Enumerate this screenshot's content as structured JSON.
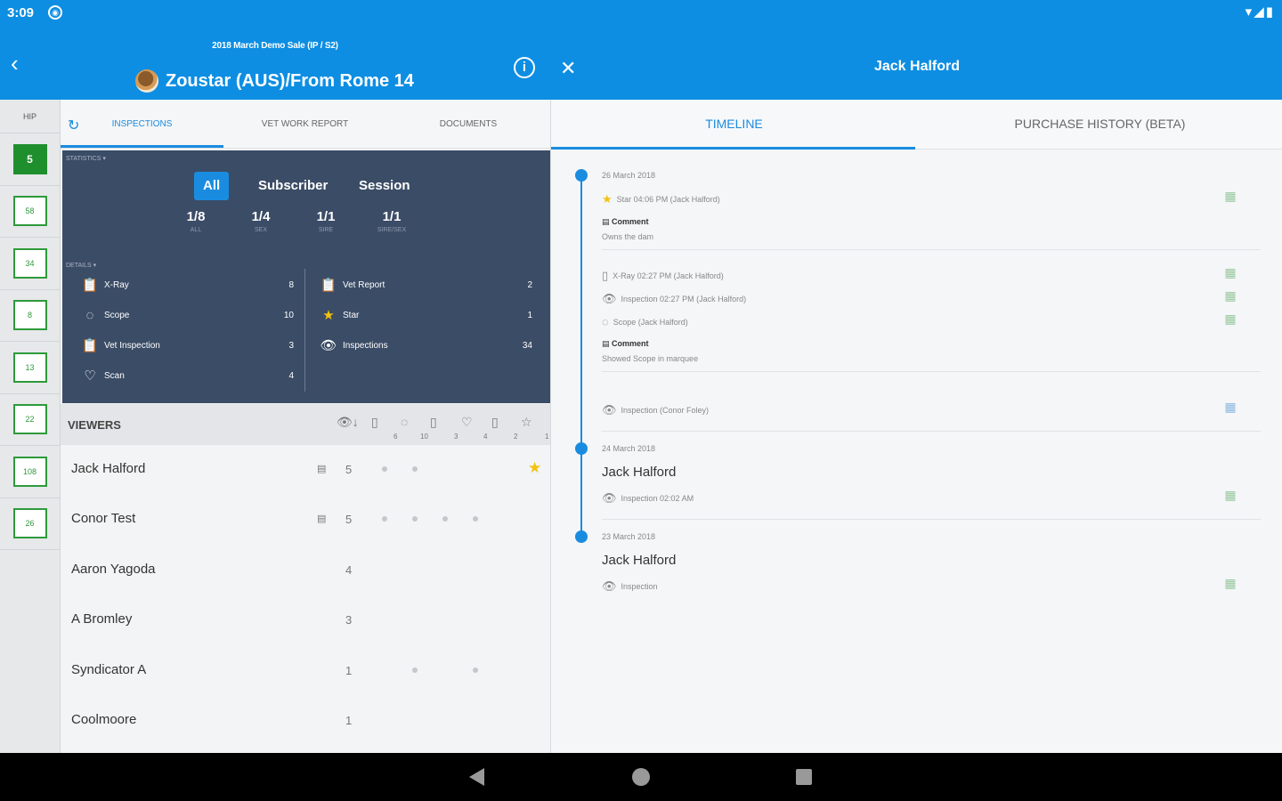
{
  "status": {
    "time": "3:09",
    "notification_icon": "notification-circle-icon",
    "system_icons": "▾◢▮"
  },
  "header": {
    "sale_title": "2018 March Demo Sale (IP / S2)",
    "horse_name": "Zoustar (AUS)/From Rome 14",
    "person_name": "Jack Halford",
    "back_glyph": "‹",
    "info_glyph": "i",
    "close_glyph": "✕"
  },
  "hip_list": {
    "label": "HIP",
    "items": [
      "5",
      "58",
      "34",
      "8",
      "13",
      "22",
      "108",
      "26"
    ]
  },
  "left_tabs": {
    "refresh_glyph": "↻",
    "items": [
      "INSPECTIONS",
      "VET WORK REPORT",
      "DOCUMENTS"
    ]
  },
  "statistics": {
    "label": "STATISTICS ▾",
    "segments": [
      "All",
      "Subscriber",
      "Session"
    ],
    "fractions": [
      {
        "value": "1/8",
        "caption": "ALL"
      },
      {
        "value": "1/4",
        "caption": "SEX"
      },
      {
        "value": "1/1",
        "caption": "SIRE"
      },
      {
        "value": "1/1",
        "caption": "SIRE/SEX"
      }
    ]
  },
  "details": {
    "label": "DETAILS ▾",
    "left": [
      {
        "icon": "clipboard-icon",
        "glyph": "📋",
        "label": "X-Ray",
        "count": "8"
      },
      {
        "icon": "scope-icon",
        "glyph": "◌",
        "label": "Scope",
        "count": "10"
      },
      {
        "icon": "clipboard-check-icon",
        "glyph": "📋",
        "label": "Vet Inspection",
        "count": "3"
      },
      {
        "icon": "heart-icon",
        "glyph": "♡",
        "label": "Scan",
        "count": "4"
      }
    ],
    "right": [
      {
        "icon": "vet-report-icon",
        "glyph": "📋",
        "label": "Vet Report",
        "count": "2"
      },
      {
        "icon": "star-icon",
        "glyph": "★",
        "label": "Star",
        "count": "1"
      },
      {
        "icon": "eye-icon",
        "glyph": "👁",
        "label": "Inspections",
        "count": "34"
      }
    ]
  },
  "viewers": {
    "label": "VIEWERS",
    "header_counts": [
      "6",
      "10",
      "3",
      "4",
      "2",
      "1"
    ],
    "rows": [
      {
        "name": "Jack Halford",
        "comment": true,
        "count": "5",
        "dots": [
          1,
          2
        ],
        "star": true
      },
      {
        "name": "Conor Test",
        "comment": true,
        "count": "5",
        "dots": [
          1,
          2,
          3,
          4
        ],
        "star": false
      },
      {
        "name": "Aaron Yagoda",
        "comment": false,
        "count": "4",
        "dots": [],
        "star": false
      },
      {
        "name": "A Bromley",
        "comment": false,
        "count": "3",
        "dots": [],
        "star": false
      },
      {
        "name": "Syndicator A",
        "comment": false,
        "count": "1",
        "dots": [
          2,
          4
        ],
        "star": false
      },
      {
        "name": "Coolmoore",
        "comment": false,
        "count": "1",
        "dots": [],
        "star": false
      }
    ]
  },
  "right_tabs": {
    "items": [
      "TIMELINE",
      "PURCHASE HISTORY (BETA)"
    ]
  },
  "timeline": [
    {
      "date": "26 March 2018",
      "entries": [
        {
          "type": "star",
          "text": "Star  04:06 PM (Jack Halford)"
        },
        {
          "type": "comment",
          "title": "Comment",
          "note": "Owns the dam"
        },
        {
          "type": "xray",
          "text": "X-Ray  02:27 PM (Jack Halford)"
        },
        {
          "type": "inspection",
          "text": "Inspection  02:27 PM (Jack Halford)"
        },
        {
          "type": "scope",
          "text": "Scope  (Jack Halford)"
        },
        {
          "type": "comment",
          "title": "Comment",
          "note": "Showed Scope in marquee"
        },
        {
          "type": "inspection",
          "text": "Inspection  (Conor Foley)"
        }
      ]
    },
    {
      "date": "24 March 2018",
      "name": "Jack Halford",
      "entries": [
        {
          "type": "inspection",
          "text": "Inspection  02:02 AM"
        }
      ]
    },
    {
      "date": "23 March 2018",
      "name": "Jack Halford",
      "entries": [
        {
          "type": "inspection",
          "text": "Inspection"
        }
      ]
    }
  ],
  "colors": {
    "primary": "#0d8ee2",
    "accent": "#1a8ce0",
    "stats_bg": "#3b4c66",
    "hip_green": "#1f8f2e",
    "star": "#f4c20d"
  }
}
